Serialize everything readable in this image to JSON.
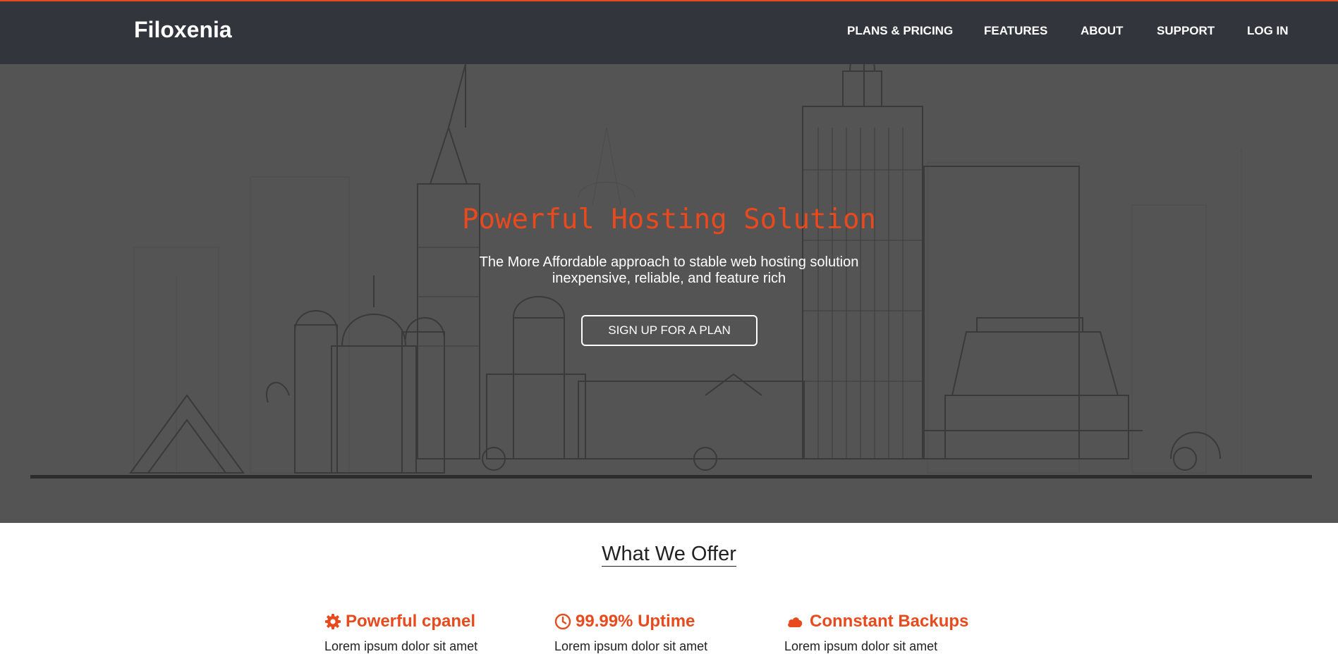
{
  "brand": {
    "name": "Filoxenia"
  },
  "nav": {
    "items": [
      {
        "label": "PLANS & PRICING"
      },
      {
        "label": "FEATURES"
      },
      {
        "label": "ABOUT"
      },
      {
        "label": "SUPPORT"
      },
      {
        "label": "LOG IN"
      }
    ]
  },
  "hero": {
    "title": "Powerful Hosting Solution",
    "subtitle_line1": "The More Affordable approach to stable web hosting solution",
    "subtitle_line2": "inexpensive, reliable, and feature rich",
    "cta_label": "SIGN UP FOR A PLAN"
  },
  "offer": {
    "heading": "What We Offer",
    "features": [
      {
        "icon": "gear-icon",
        "title": "Powerful cpanel",
        "text": "Lorem ipsum dolor sit amet"
      },
      {
        "icon": "clock-icon",
        "title": "99.99% Uptime",
        "text": "Lorem ipsum dolor sit amet"
      },
      {
        "icon": "cloud-icon",
        "title": "Connstant Backups",
        "text": "Lorem ipsum dolor sit amet"
      }
    ]
  },
  "colors": {
    "accent": "#e84a1d",
    "navbar": "#32353c",
    "hero_bg": "#545454",
    "skyline": "#3a3a3a"
  }
}
